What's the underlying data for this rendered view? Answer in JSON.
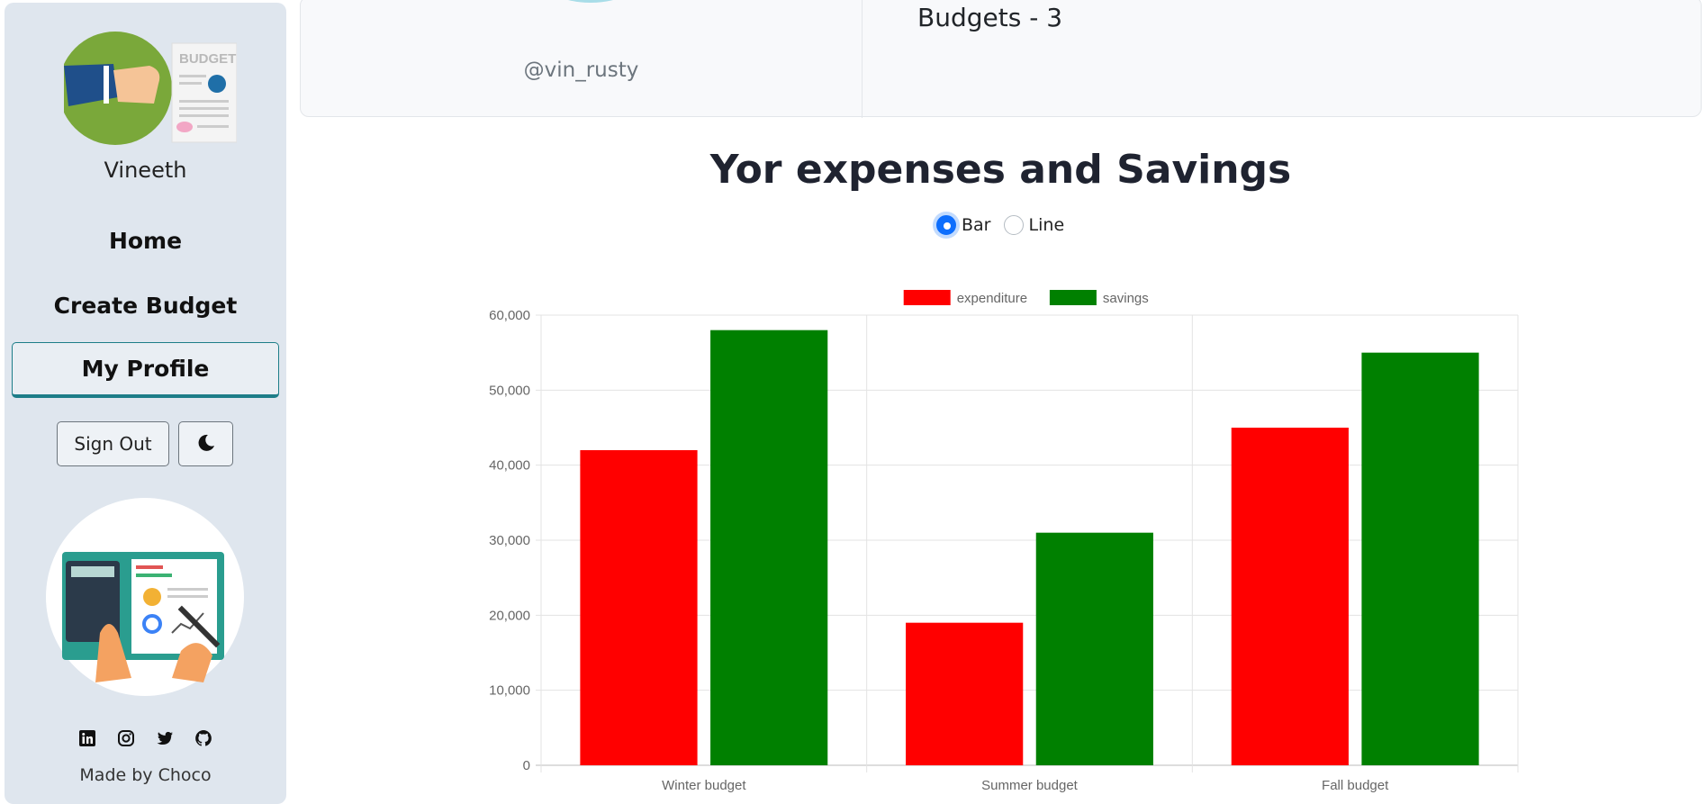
{
  "sidebar": {
    "username": "Vineeth",
    "nav": [
      {
        "label": "Home"
      },
      {
        "label": "Create Budget"
      },
      {
        "label": "My Profile",
        "active": true
      }
    ],
    "sign_out_label": "Sign Out",
    "theme_toggle_icon": "moon-icon",
    "logo_text": "BUDGET",
    "socials": [
      "linkedin-icon",
      "instagram-icon",
      "twitter-icon",
      "github-icon"
    ],
    "credit": "Made by Choco"
  },
  "profile": {
    "handle": "@vin_rusty",
    "budgets_text": "Budgets - 3"
  },
  "main": {
    "heading": "Yor expenses and Savings",
    "chart_type_options": [
      {
        "label": "Bar",
        "checked": true
      },
      {
        "label": "Line",
        "checked": false
      }
    ]
  },
  "colors": {
    "sidebar_bg": "#dfe6ee",
    "accent": "#1d7d88",
    "expenditure": "#ff0000",
    "savings": "#008000"
  },
  "chart_data": {
    "type": "bar",
    "categories": [
      "Winter budget",
      "Summer budget",
      "Fall budget"
    ],
    "series": [
      {
        "name": "expenditure",
        "values": [
          42000,
          19000,
          45000
        ],
        "color": "#ff0000"
      },
      {
        "name": "savings",
        "values": [
          58000,
          31000,
          55000
        ],
        "color": "#008000"
      }
    ],
    "ylim": [
      0,
      60000
    ],
    "yticks": [
      "0",
      "10,000",
      "20,000",
      "30,000",
      "40,000",
      "50,000",
      "60,000"
    ],
    "yticks_values": [
      0,
      10000,
      20000,
      30000,
      40000,
      50000,
      60000
    ],
    "legend": "top",
    "grid": true
  }
}
